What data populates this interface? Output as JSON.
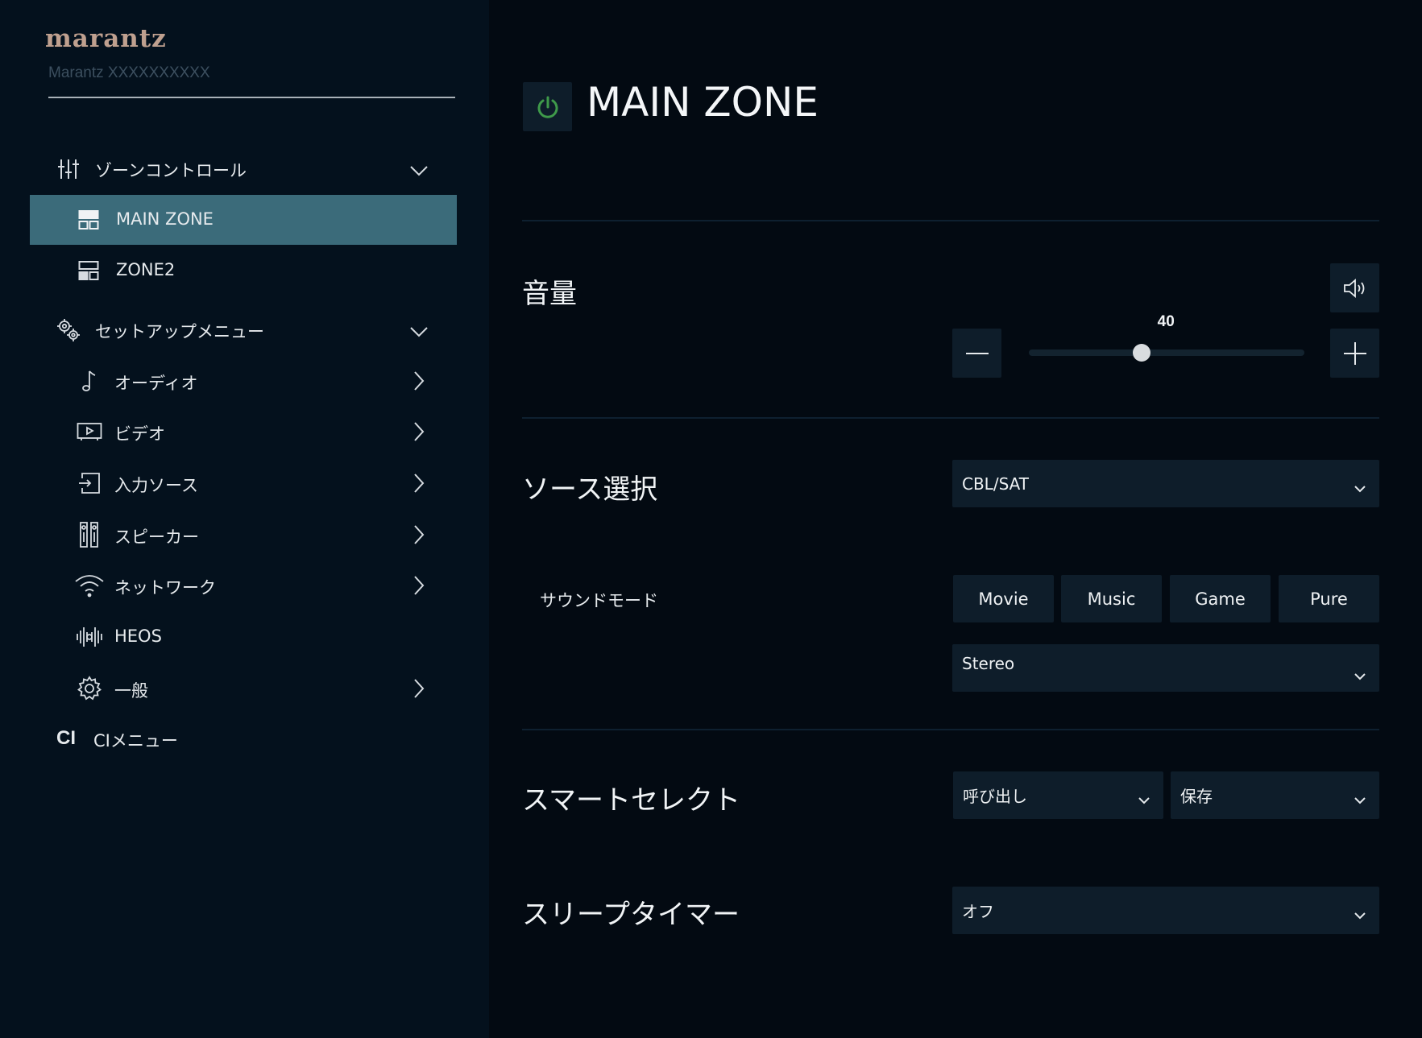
{
  "brand": {
    "logo_text": "marantz",
    "device_name": "Marantz XXXXXXXXXX",
    "logo_color": "#bfa08f"
  },
  "sidebar": {
    "zone_control": {
      "label": "ゾーンコントロール",
      "icon": "sliders-icon"
    },
    "zones": [
      {
        "label": "MAIN ZONE",
        "icon": "zone-icon",
        "active": true
      },
      {
        "label": "ZONE2",
        "icon": "zone-icon",
        "active": false
      }
    ],
    "setup_menu": {
      "label": "セットアップメニュー",
      "icon": "gears-icon"
    },
    "setup_items": [
      {
        "label": "オーディオ",
        "icon": "music-note-icon"
      },
      {
        "label": "ビデオ",
        "icon": "video-icon"
      },
      {
        "label": "入力ソース",
        "icon": "input-icon"
      },
      {
        "label": "スピーカー",
        "icon": "speaker-icon"
      },
      {
        "label": "ネットワーク",
        "icon": "wifi-icon"
      },
      {
        "label": "HEOS",
        "icon": "heos-icon"
      },
      {
        "label": "一般",
        "icon": "gear-icon"
      }
    ],
    "ci_menu": {
      "icon_text": "CI",
      "label": "CIメニュー"
    },
    "active_color": "#3b6b7a"
  },
  "main": {
    "zone_title": "MAIN ZONE",
    "power_icon": "power-icon",
    "power_color": "#3f9a4a",
    "volume": {
      "title": "音量",
      "value": "40",
      "level_fraction": 0.41
    },
    "source": {
      "title": "ソース選択",
      "selected": "CBL/SAT"
    },
    "sound_mode": {
      "title": "サウンドモード",
      "buttons": [
        "Movie",
        "Music",
        "Game",
        "Pure"
      ],
      "selected": "Stereo"
    },
    "smart_select": {
      "title": "スマートセレクト",
      "recall": "呼び出し",
      "save": "保存"
    },
    "sleep_timer": {
      "title": "スリープタイマー",
      "selected": "オフ"
    }
  }
}
